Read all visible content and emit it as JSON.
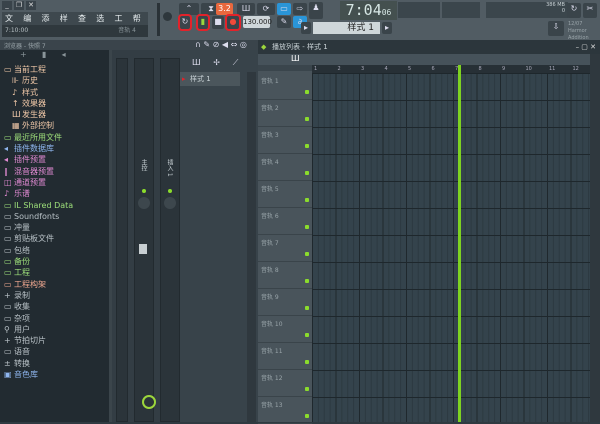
{
  "menu": [
    "文件",
    "编辑",
    "添加",
    "样式",
    "查看",
    "选项",
    "工具",
    "帮助"
  ],
  "hint": {
    "time": "7:10:00",
    "track": "音轨 4"
  },
  "transport": {
    "tempo": "130.000",
    "time": "7:04",
    "time_small": "06",
    "pattern": "样式 1",
    "song_mode": "3.2"
  },
  "cpu": {
    "mem": "386 MB",
    "val": "0"
  },
  "news": {
    "date": "12/07",
    "line1": "Harmor",
    "line2": "Addition"
  },
  "browser": {
    "header": "浏览器 - 快照 7",
    "items": [
      {
        "label": "当前工程",
        "icon": "folder-icon",
        "color": "#f0c8a8",
        "indent": 0
      },
      {
        "label": "历史",
        "icon": "history-icon",
        "color": "#f0c8a8",
        "indent": 1
      },
      {
        "label": "样式",
        "icon": "note-icon",
        "color": "#f0c8a8",
        "indent": 1
      },
      {
        "label": "效果器",
        "icon": "effect-icon",
        "color": "#f0c8a8",
        "indent": 1
      },
      {
        "label": "发生器",
        "icon": "piano-icon",
        "color": "#f0c8a8",
        "indent": 1
      },
      {
        "label": "外部控制",
        "icon": "controller-icon",
        "color": "#f0c8a8",
        "indent": 1
      },
      {
        "label": "最近所用文件",
        "icon": "folder-icon",
        "color": "#9ee07a",
        "indent": 0
      },
      {
        "label": "插件数据库",
        "icon": "plugin-icon",
        "color": "#8fb6ef",
        "indent": 0
      },
      {
        "label": "插件预置",
        "icon": "plugin-icon",
        "color": "#e08ad2",
        "indent": 0
      },
      {
        "label": "混音器预置",
        "icon": "mixer-icon",
        "color": "#e08ad2",
        "indent": 0
      },
      {
        "label": "通道预置",
        "icon": "channel-icon",
        "color": "#e08ad2",
        "indent": 0
      },
      {
        "label": "乐谱",
        "icon": "note-icon",
        "color": "#e08ad2",
        "indent": 0
      },
      {
        "label": "IL Shared Data",
        "icon": "folder-icon",
        "color": "#9ee07a",
        "indent": 0
      },
      {
        "label": "Soundfonts",
        "icon": "folder-icon",
        "color": "#b9c2c7",
        "indent": 0
      },
      {
        "label": "冲量",
        "icon": "folder-icon",
        "color": "#b9c2c7",
        "indent": 0
      },
      {
        "label": "剪贴板文件",
        "icon": "folder-icon",
        "color": "#b9c2c7",
        "indent": 0
      },
      {
        "label": "包络",
        "icon": "folder-icon",
        "color": "#b9c2c7",
        "indent": 0
      },
      {
        "label": "备份",
        "icon": "folder-icon",
        "color": "#9ee07a",
        "indent": 0
      },
      {
        "label": "工程",
        "icon": "folder-icon",
        "color": "#9ee07a",
        "indent": 0
      },
      {
        "label": "工程构架",
        "icon": "folder-icon",
        "color": "#f0a890",
        "indent": 0
      },
      {
        "label": "录制",
        "icon": "plus-icon",
        "color": "#b9c2c7",
        "indent": 0
      },
      {
        "label": "收集",
        "icon": "folder-icon",
        "color": "#b9c2c7",
        "indent": 0
      },
      {
        "label": "杂项",
        "icon": "folder-icon",
        "color": "#b9c2c7",
        "indent": 0
      },
      {
        "label": "用户",
        "icon": "user-icon",
        "color": "#b9c2c7",
        "indent": 0
      },
      {
        "label": "节拍切片",
        "icon": "plus-icon",
        "color": "#b9c2c7",
        "indent": 0
      },
      {
        "label": "语音",
        "icon": "folder-icon",
        "color": "#b9c2c7",
        "indent": 0
      },
      {
        "label": "转换",
        "icon": "convert-icon",
        "color": "#b9c2c7",
        "indent": 0
      },
      {
        "label": "音色库",
        "icon": "library-icon",
        "color": "#8fb6ef",
        "indent": 0
      }
    ]
  },
  "mixer": {
    "strip_labels": [
      "主控",
      "插入 1"
    ]
  },
  "picker": {
    "patterns": [
      "样式 1"
    ]
  },
  "playlist": {
    "title": "播放列表 - 样式 1",
    "ruler": [
      "1",
      "2",
      "3",
      "4",
      "5",
      "6",
      "7",
      "8",
      "9",
      "10",
      "11",
      "12"
    ],
    "tracks": [
      "音轨 1",
      "音轨 2",
      "音轨 3",
      "音轨 4",
      "音轨 5",
      "音轨 6",
      "音轨 7",
      "音轨 8",
      "音轨 9",
      "音轨 10",
      "音轨 11",
      "音轨 12",
      "音轨 13"
    ],
    "playhead_bar": 7.1
  },
  "colors": {
    "accent": "#7ed321",
    "highlight": "#e3222a"
  }
}
